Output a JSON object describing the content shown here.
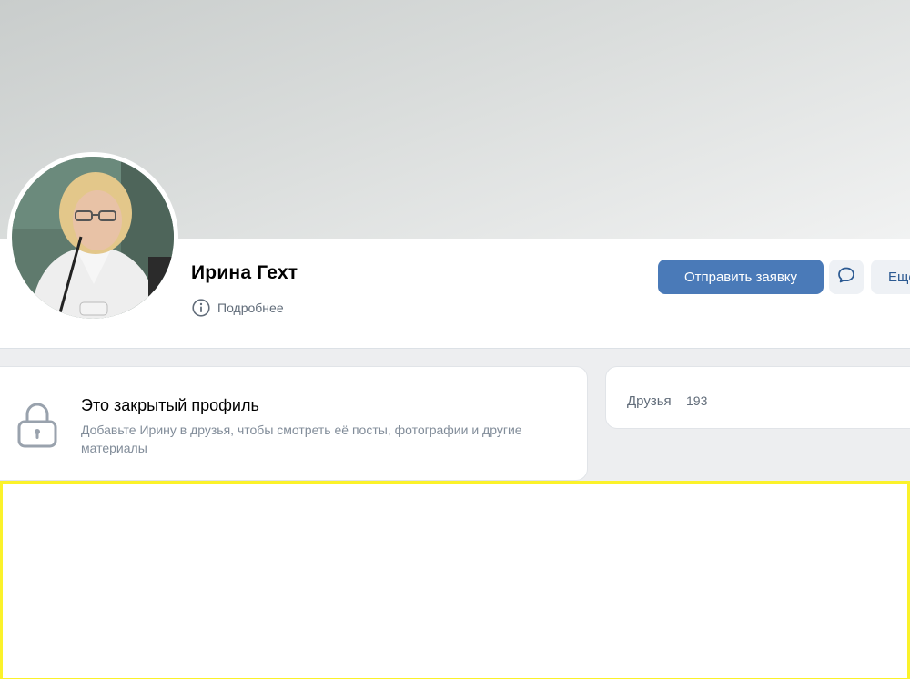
{
  "profile": {
    "name": "Ирина Гехт",
    "more_info_label": "Подробнее"
  },
  "actions": {
    "send_request_label": "Отправить заявку",
    "more_label": "Ещё"
  },
  "private_notice": {
    "title": "Это закрытый профиль",
    "description": "Добавьте Ирину в друзья, чтобы смотреть её посты, фотографии и другие материалы"
  },
  "friends": {
    "label": "Друзья",
    "count": "193"
  },
  "colors": {
    "primary_button": "#4a7ab8",
    "secondary_button": "#eef1f5",
    "page_background": "#edeef0",
    "highlight_border": "#fbf22a"
  },
  "icons": {
    "info": "info-circle-icon",
    "message": "message-bubble-icon",
    "lock": "lock-icon"
  }
}
